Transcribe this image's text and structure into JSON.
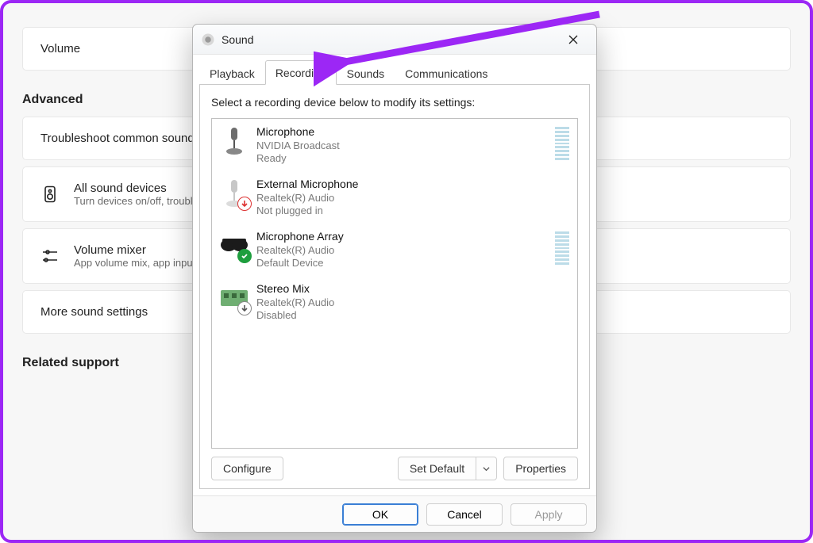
{
  "bg": {
    "volume": "Volume",
    "advanced": "Advanced",
    "troubleshoot": "Troubleshoot common sound problems",
    "allSoundDevices": {
      "title": "All sound devices",
      "sub": "Turn devices on/off, troubleshoot, other options"
    },
    "volumeMixer": {
      "title": "Volume mixer",
      "sub": "App volume mix, app input & output devices"
    },
    "moreSoundSettings": "More sound settings",
    "relatedSupport": "Related support"
  },
  "dialog": {
    "title": "Sound",
    "tabs": [
      "Playback",
      "Recording",
      "Sounds",
      "Communications"
    ],
    "activeTab": 1,
    "instruction": "Select a recording device below to modify its settings:",
    "devices": [
      {
        "name": "Microphone",
        "vendor": "NVIDIA Broadcast",
        "status": "Ready",
        "icon": "mic-stand",
        "badge": "",
        "meter": true
      },
      {
        "name": "External Microphone",
        "vendor": "Realtek(R) Audio",
        "status": "Not plugged in",
        "icon": "mic-stand-dim",
        "badge": "down-red",
        "meter": false
      },
      {
        "name": "Microphone Array",
        "vendor": "Realtek(R) Audio",
        "status": "Default Device",
        "icon": "headset",
        "badge": "check-green",
        "meter": true
      },
      {
        "name": "Stereo Mix",
        "vendor": "Realtek(R) Audio",
        "status": "Disabled",
        "icon": "board",
        "badge": "down-grey",
        "meter": false
      }
    ],
    "buttons": {
      "configure": "Configure",
      "setDefault": "Set Default",
      "properties": "Properties",
      "ok": "OK",
      "cancel": "Cancel",
      "apply": "Apply"
    }
  }
}
